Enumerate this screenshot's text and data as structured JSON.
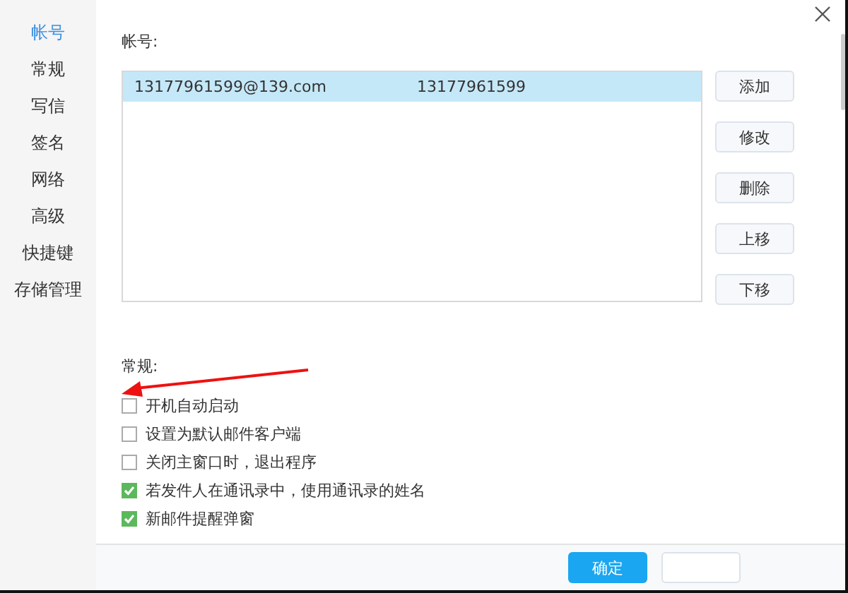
{
  "sidebar": {
    "items": [
      {
        "label": "帐号",
        "selected": true
      },
      {
        "label": "常规",
        "selected": false
      },
      {
        "label": "写信",
        "selected": false
      },
      {
        "label": "签名",
        "selected": false
      },
      {
        "label": "网络",
        "selected": false
      },
      {
        "label": "高级",
        "selected": false
      },
      {
        "label": "快捷键",
        "selected": false
      },
      {
        "label": "存储管理",
        "selected": false
      }
    ]
  },
  "accounts": {
    "label": "帐号:",
    "rows": [
      {
        "email": "13177961599@139.com",
        "column_2": "13177961599",
        "selected": true
      }
    ],
    "buttons": [
      "添加",
      "修改",
      "删除",
      "上移",
      "下移"
    ]
  },
  "general": {
    "label": "常规:",
    "options": [
      {
        "label": "开机自动启动",
        "checked": false
      },
      {
        "label": "设置为默认邮件客户端",
        "checked": false
      },
      {
        "label": "关闭主窗口时，退出程序",
        "checked": false
      },
      {
        "label": "若发件人在通讯录中，使用通讯录的姓名",
        "checked": true
      },
      {
        "label": "新邮件提醒弹窗",
        "checked": true
      }
    ]
  },
  "footer": {
    "buttons": [
      {
        "label": "确定",
        "kind": "primary"
      },
      {
        "kind": "secondary"
      }
    ]
  }
}
